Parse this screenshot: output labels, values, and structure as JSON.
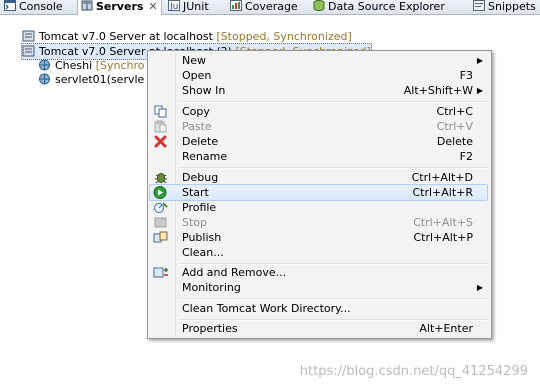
{
  "tabs": [
    {
      "label": "Console",
      "icon": "console-icon",
      "active": false
    },
    {
      "label": "Servers",
      "icon": "servers-icon",
      "active": true,
      "close": "✕"
    },
    {
      "label": "JUnit",
      "icon": "junit-icon",
      "active": false
    },
    {
      "label": "Coverage",
      "icon": "coverage-icon",
      "active": false
    },
    {
      "label": "Data Source Explorer",
      "icon": "data-source-icon",
      "active": false
    },
    {
      "label": "Snippets",
      "icon": "snippets-icon",
      "active": false
    }
  ],
  "servers": [
    {
      "name": "Tomcat v7.0 Server at localhost",
      "status": "[Stopped, Synchronized]"
    },
    {
      "name": "Tomcat v7.0 Server at localhost (2)",
      "status": "[Stopped, Synchronized]",
      "selected": true,
      "children": [
        {
          "name": "Cheshi",
          "status": "[Synchro"
        },
        {
          "name": "servlet01(servle",
          "status": ""
        }
      ]
    }
  ],
  "menu": {
    "new": {
      "label": "New",
      "shortcut": ""
    },
    "open": {
      "label": "Open",
      "shortcut": "F3"
    },
    "show_in": {
      "label": "Show In",
      "shortcut": "Alt+Shift+W"
    },
    "copy": {
      "label": "Copy",
      "shortcut": "Ctrl+C"
    },
    "paste": {
      "label": "Paste",
      "shortcut": "Ctrl+V"
    },
    "delete": {
      "label": "Delete",
      "shortcut": "Delete"
    },
    "rename": {
      "label": "Rename",
      "shortcut": "F2"
    },
    "debug": {
      "label": "Debug",
      "shortcut": "Ctrl+Alt+D"
    },
    "start": {
      "label": "Start",
      "shortcut": "Ctrl+Alt+R"
    },
    "profile": {
      "label": "Profile",
      "shortcut": ""
    },
    "stop": {
      "label": "Stop",
      "shortcut": "Ctrl+Alt+S"
    },
    "publish": {
      "label": "Publish",
      "shortcut": "Ctrl+Alt+P"
    },
    "clean": {
      "label": "Clean...",
      "shortcut": ""
    },
    "add_remove": {
      "label": "Add and Remove...",
      "shortcut": ""
    },
    "monitoring": {
      "label": "Monitoring",
      "shortcut": ""
    },
    "clean_work_dir": {
      "label": "Clean Tomcat Work Directory...",
      "shortcut": ""
    },
    "properties": {
      "label": "Properties",
      "shortcut": "Alt+Enter"
    }
  },
  "watermark": "https://blog.csdn.net/qq_41254299",
  "colors": {
    "status": "#99792c",
    "selection": "#dde8f8",
    "hover_border": "#aecef7",
    "start_green": "#2e9e3a",
    "delete_red": "#d8322b"
  }
}
